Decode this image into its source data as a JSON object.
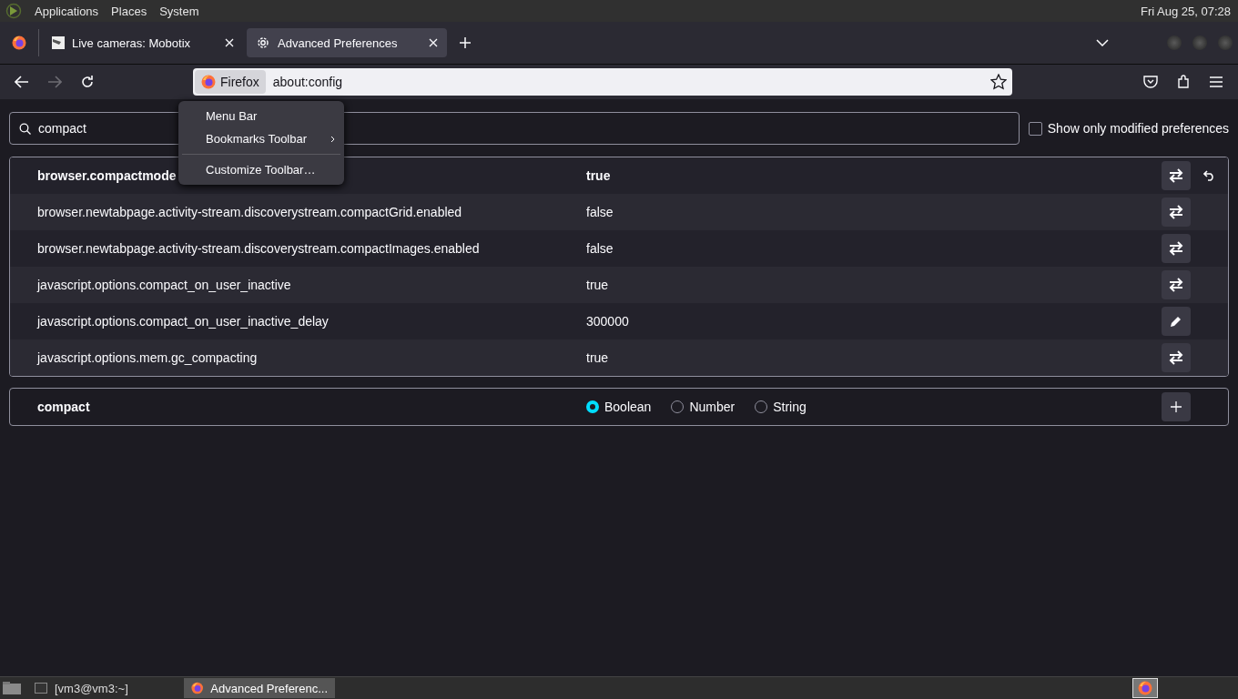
{
  "top_panel": {
    "menus": [
      "Applications",
      "Places",
      "System"
    ],
    "clock": "Fri Aug 25, 07:28"
  },
  "tabs": [
    {
      "label": "Live cameras: Mobotix",
      "selected": false,
      "kind": "camera"
    },
    {
      "label": "Advanced Preferences",
      "selected": true,
      "kind": "settings"
    }
  ],
  "address_bar": {
    "identity": "Firefox",
    "url": "about:config"
  },
  "search": {
    "value": "compact"
  },
  "show_modified": {
    "label": "Show only modified preferences",
    "checked": false
  },
  "prefs": [
    {
      "name": "browser.compactmode",
      "value": "true",
      "modified": true,
      "kind": "toggle"
    },
    {
      "name": "browser.newtabpage.activity-stream.discoverystream.compactGrid.enabled",
      "value": "false",
      "modified": false,
      "kind": "toggle"
    },
    {
      "name": "browser.newtabpage.activity-stream.discoverystream.compactImages.enabled",
      "value": "false",
      "modified": false,
      "kind": "toggle"
    },
    {
      "name": "javascript.options.compact_on_user_inactive",
      "value": "true",
      "modified": false,
      "kind": "toggle"
    },
    {
      "name": "javascript.options.compact_on_user_inactive_delay",
      "value": "300000",
      "modified": false,
      "kind": "edit"
    },
    {
      "name": "javascript.options.mem.gc_compacting",
      "value": "true",
      "modified": false,
      "kind": "toggle"
    }
  ],
  "new_pref": {
    "name": "compact",
    "types": [
      {
        "label": "Boolean",
        "selected": true
      },
      {
        "label": "Number",
        "selected": false
      },
      {
        "label": "String",
        "selected": false
      }
    ]
  },
  "context_menu": {
    "items": [
      {
        "label": "Menu Bar",
        "kind": "item",
        "separator_before": false
      },
      {
        "label": "Bookmarks Toolbar",
        "kind": "submenu",
        "separator_before": false
      },
      {
        "label": "Customize Toolbar…",
        "kind": "item",
        "separator_before": true
      }
    ]
  },
  "taskbar": {
    "items": [
      {
        "label": "[vm3@vm3:~]",
        "selected": false,
        "kind": "terminal"
      },
      {
        "label": "Advanced Preferenc...",
        "selected": true,
        "kind": "browser"
      }
    ]
  }
}
